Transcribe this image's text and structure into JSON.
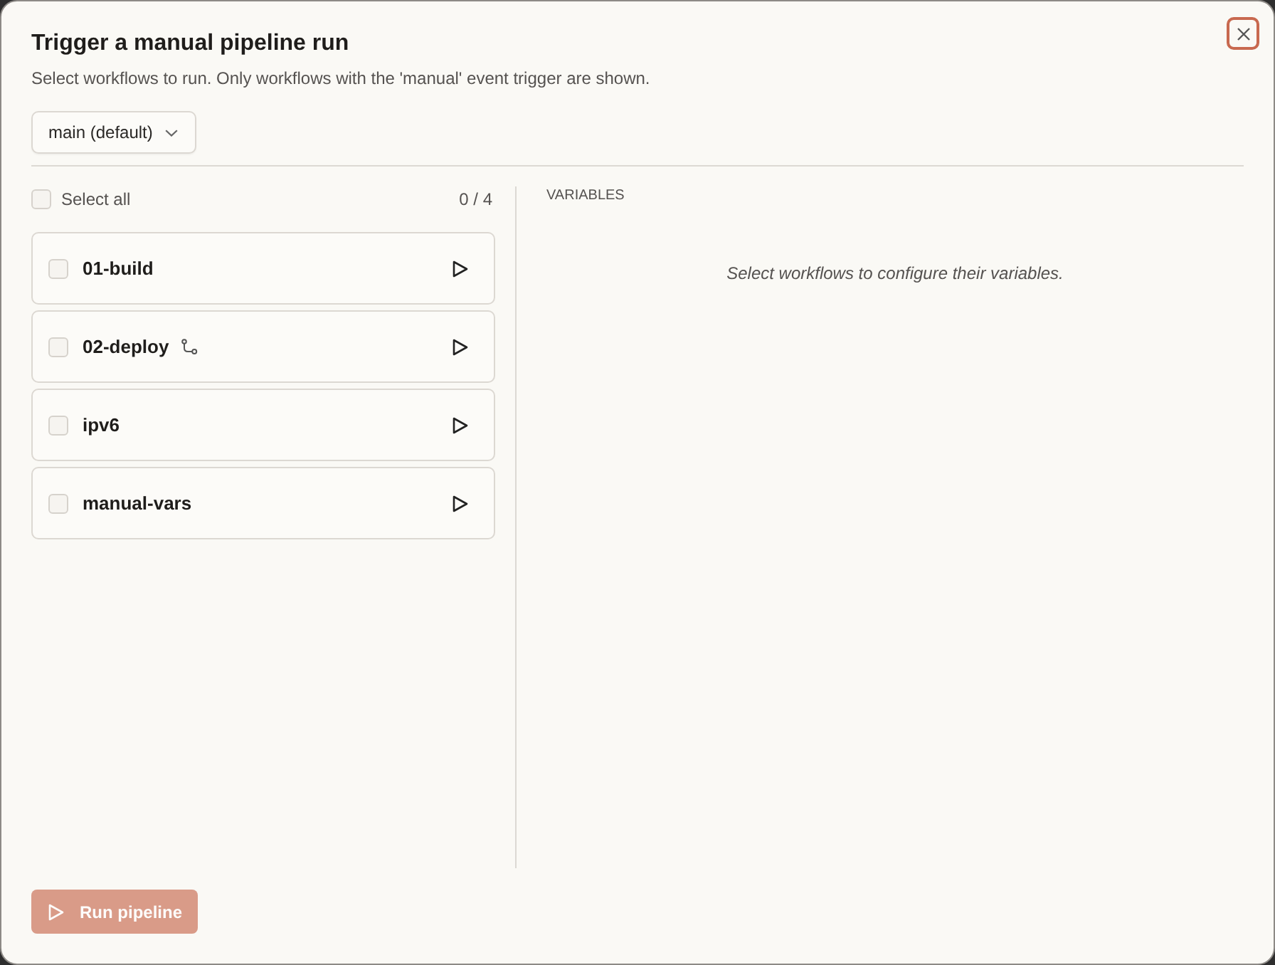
{
  "dialog": {
    "title": "Trigger a manual pipeline run",
    "subtitle": "Select workflows to run. Only workflows with the 'manual' event trigger are shown.",
    "close_button": {
      "focused": true
    }
  },
  "branch_select": {
    "value": "main (default)"
  },
  "workflows": {
    "select_all": {
      "label": "Select all",
      "checked": false
    },
    "count": "0 / 4",
    "items": [
      {
        "name": "01-build",
        "checked": false,
        "branch_icon": false
      },
      {
        "name": "02-deploy",
        "checked": false,
        "branch_icon": true
      },
      {
        "name": "ipv6",
        "checked": false,
        "branch_icon": false
      },
      {
        "name": "manual-vars",
        "checked": false,
        "branch_icon": false
      }
    ]
  },
  "variables": {
    "heading": "VARIABLES",
    "empty_message": "Select workflows to configure their variables."
  },
  "run_button": {
    "label": "Run pipeline",
    "disabled": true
  }
}
